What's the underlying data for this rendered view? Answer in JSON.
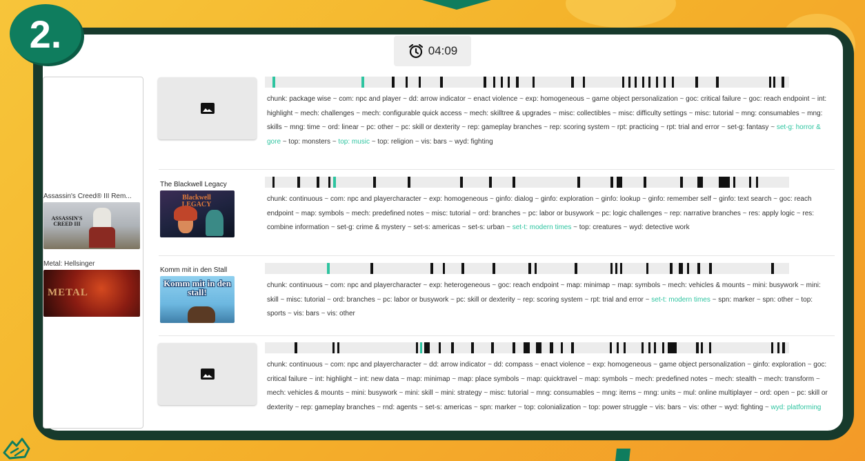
{
  "badge": {
    "step": "2."
  },
  "timer": {
    "time": "04:09",
    "icon": "alarm-clock-icon"
  },
  "left_panel": {
    "items": [
      {
        "title": "Assassin's Creed® III Rem...",
        "thumb_text": "ASSASSIN'S CREED III"
      },
      {
        "title": "Metal: Hellsinger",
        "thumb_text": "METAL"
      }
    ]
  },
  "rows": [
    {
      "title": "",
      "has_image": false,
      "marks": [
        [
          0.014,
          0.006,
          "teal"
        ],
        [
          0.184,
          0.006,
          "teal"
        ],
        [
          0.242,
          0.005,
          ""
        ],
        [
          0.268,
          0.005,
          ""
        ],
        [
          0.293,
          0.005,
          ""
        ],
        [
          0.334,
          0.005,
          ""
        ],
        [
          0.417,
          0.005,
          ""
        ],
        [
          0.436,
          0.004,
          ""
        ],
        [
          0.45,
          0.004,
          ""
        ],
        [
          0.463,
          0.004,
          ""
        ],
        [
          0.479,
          0.005,
          ""
        ],
        [
          0.51,
          0.005,
          ""
        ],
        [
          0.584,
          0.005,
          ""
        ],
        [
          0.606,
          0.005,
          ""
        ],
        [
          0.681,
          0.004,
          ""
        ],
        [
          0.693,
          0.004,
          ""
        ],
        [
          0.705,
          0.004,
          ""
        ],
        [
          0.72,
          0.004,
          ""
        ],
        [
          0.732,
          0.004,
          ""
        ],
        [
          0.746,
          0.004,
          ""
        ],
        [
          0.76,
          0.004,
          ""
        ],
        [
          0.776,
          0.004,
          ""
        ],
        [
          0.821,
          0.005,
          ""
        ],
        [
          0.861,
          0.005,
          ""
        ],
        [
          0.962,
          0.004,
          ""
        ],
        [
          0.97,
          0.004,
          ""
        ],
        [
          0.985,
          0.006,
          ""
        ]
      ],
      "tags": [
        {
          "t": "chunk: package wise"
        },
        {
          "t": "com: npc and player"
        },
        {
          "t": "dd: arrow indicator"
        },
        {
          "t": "enact violence"
        },
        {
          "t": "exp: homogeneous"
        },
        {
          "t": "game object personalization"
        },
        {
          "t": "goc: critical failure"
        },
        {
          "t": "goc: reach endpoint"
        },
        {
          "t": "int: highlight"
        },
        {
          "t": "mech: challenges"
        },
        {
          "t": "mech: configurable quick access"
        },
        {
          "t": "mech: skilltree & upgrades"
        },
        {
          "t": "misc: collectibles"
        },
        {
          "t": "misc: difficulty settings"
        },
        {
          "t": "misc: tutorial"
        },
        {
          "t": "mng: consumables"
        },
        {
          "t": "mng: skills"
        },
        {
          "t": "mng: time"
        },
        {
          "t": "ord: linear"
        },
        {
          "t": "pc: other"
        },
        {
          "t": "pc: skill or dexterity"
        },
        {
          "t": "rep: gameplay branches"
        },
        {
          "t": "rep: scoring system"
        },
        {
          "t": "rpt: practicing"
        },
        {
          "t": "rpt: trial and error"
        },
        {
          "t": "set-g: fantasy"
        },
        {
          "t": "set-g: horror & gore",
          "hl": true
        },
        {
          "t": "top: monsters"
        },
        {
          "t": "top: music",
          "hl": true
        },
        {
          "t": "top: religion"
        },
        {
          "t": "vis: bars"
        },
        {
          "t": "wyd: fighting"
        }
      ]
    },
    {
      "title": "The Blackwell Legacy",
      "has_image": true,
      "thumb_text": "Blackwell LEGACY",
      "marks": [
        [
          0.014,
          0.005,
          ""
        ],
        [
          0.062,
          0.005,
          ""
        ],
        [
          0.099,
          0.005,
          ""
        ],
        [
          0.121,
          0.004,
          ""
        ],
        [
          0.13,
          0.005,
          "teal"
        ],
        [
          0.207,
          0.005,
          ""
        ],
        [
          0.273,
          0.005,
          ""
        ],
        [
          0.373,
          0.005,
          ""
        ],
        [
          0.428,
          0.005,
          ""
        ],
        [
          0.472,
          0.005,
          ""
        ],
        [
          0.596,
          0.005,
          ""
        ],
        [
          0.659,
          0.005,
          ""
        ],
        [
          0.671,
          0.01,
          ""
        ],
        [
          0.723,
          0.005,
          ""
        ],
        [
          0.792,
          0.005,
          ""
        ],
        [
          0.825,
          0.01,
          ""
        ],
        [
          0.866,
          0.021,
          ""
        ],
        [
          0.893,
          0.005,
          ""
        ],
        [
          0.924,
          0.004,
          ""
        ],
        [
          0.937,
          0.004,
          ""
        ]
      ],
      "tags": [
        {
          "t": "chunk: continuous"
        },
        {
          "t": "com: npc and playercharacter"
        },
        {
          "t": "exp: homogeneous"
        },
        {
          "t": "ginfo: dialog"
        },
        {
          "t": "ginfo: exploration"
        },
        {
          "t": "ginfo: lookup"
        },
        {
          "t": "ginfo: remember self"
        },
        {
          "t": "ginfo: text search"
        },
        {
          "t": "goc: reach endpoint"
        },
        {
          "t": "map: symbols"
        },
        {
          "t": "mech: predefined notes"
        },
        {
          "t": "misc: tutorial"
        },
        {
          "t": "ord: branches"
        },
        {
          "t": "pc: labor or busywork"
        },
        {
          "t": "pc: logic challenges"
        },
        {
          "t": "rep: narrative branches"
        },
        {
          "t": "res: apply logic"
        },
        {
          "t": "res: combine information"
        },
        {
          "t": "set-g: crime & mystery"
        },
        {
          "t": "set-s: americas"
        },
        {
          "t": "set-s: urban"
        },
        {
          "t": "set-t: modern times",
          "hl": true
        },
        {
          "t": "top: creatures"
        },
        {
          "t": "wyd: detective work"
        }
      ]
    },
    {
      "title": "Komm mit in den Stall",
      "has_image": true,
      "thumb_text": "Komm mit in den stall!",
      "marks": [
        [
          0.119,
          0.005,
          "teal"
        ],
        [
          0.201,
          0.005,
          ""
        ],
        [
          0.316,
          0.005,
          ""
        ],
        [
          0.339,
          0.005,
          ""
        ],
        [
          0.375,
          0.005,
          ""
        ],
        [
          0.434,
          0.005,
          ""
        ],
        [
          0.503,
          0.005,
          ""
        ],
        [
          0.514,
          0.005,
          ""
        ],
        [
          0.591,
          0.005,
          ""
        ],
        [
          0.659,
          0.004,
          ""
        ],
        [
          0.668,
          0.004,
          ""
        ],
        [
          0.678,
          0.004,
          ""
        ],
        [
          0.727,
          0.005,
          ""
        ],
        [
          0.772,
          0.005,
          ""
        ],
        [
          0.789,
          0.008,
          ""
        ],
        [
          0.805,
          0.004,
          ""
        ],
        [
          0.825,
          0.005,
          ""
        ],
        [
          0.848,
          0.005,
          ""
        ],
        [
          0.966,
          0.005,
          ""
        ]
      ],
      "tags": [
        {
          "t": "chunk: continuous"
        },
        {
          "t": "com: npc and playercharacter"
        },
        {
          "t": "exp: heterogeneous"
        },
        {
          "t": "goc: reach endpoint"
        },
        {
          "t": "map: minimap"
        },
        {
          "t": "map: symbols"
        },
        {
          "t": "mech: vehicles & mounts"
        },
        {
          "t": "mini: busywork"
        },
        {
          "t": "mini: skill"
        },
        {
          "t": "misc: tutorial"
        },
        {
          "t": "ord: branches"
        },
        {
          "t": "pc: labor or busywork"
        },
        {
          "t": "pc: skill or dexterity"
        },
        {
          "t": "rep: scoring system"
        },
        {
          "t": "rpt: trial and error"
        },
        {
          "t": "set-t: modern times",
          "hl": true
        },
        {
          "t": "spn: marker"
        },
        {
          "t": "spn: other"
        },
        {
          "t": "top: sports"
        },
        {
          "t": "vis: bars"
        },
        {
          "t": "vis: other"
        }
      ]
    },
    {
      "title": "",
      "has_image": false,
      "marks": [
        [
          0.057,
          0.005,
          ""
        ],
        [
          0.129,
          0.004,
          ""
        ],
        [
          0.138,
          0.004,
          ""
        ],
        [
          0.288,
          0.004,
          ""
        ],
        [
          0.296,
          0.004,
          "teal"
        ],
        [
          0.304,
          0.01,
          ""
        ],
        [
          0.331,
          0.005,
          ""
        ],
        [
          0.355,
          0.005,
          ""
        ],
        [
          0.394,
          0.005,
          ""
        ],
        [
          0.432,
          0.005,
          ""
        ],
        [
          0.473,
          0.005,
          ""
        ],
        [
          0.493,
          0.012,
          ""
        ],
        [
          0.517,
          0.01,
          ""
        ],
        [
          0.544,
          0.006,
          ""
        ],
        [
          0.564,
          0.004,
          ""
        ],
        [
          0.584,
          0.005,
          ""
        ],
        [
          0.658,
          0.004,
          ""
        ],
        [
          0.671,
          0.004,
          ""
        ],
        [
          0.684,
          0.004,
          ""
        ],
        [
          0.718,
          0.004,
          ""
        ],
        [
          0.731,
          0.004,
          ""
        ],
        [
          0.742,
          0.004,
          ""
        ],
        [
          0.758,
          0.004,
          ""
        ],
        [
          0.768,
          0.018,
          ""
        ],
        [
          0.823,
          0.004,
          ""
        ],
        [
          0.832,
          0.004,
          ""
        ],
        [
          0.847,
          0.004,
          ""
        ],
        [
          0.966,
          0.004,
          ""
        ],
        [
          0.977,
          0.004,
          ""
        ],
        [
          0.987,
          0.005,
          ""
        ]
      ],
      "tags": [
        {
          "t": "chunk: continuous"
        },
        {
          "t": "com: npc and playercharacter"
        },
        {
          "t": "dd: arrow indicator"
        },
        {
          "t": "dd: compass"
        },
        {
          "t": "enact violence"
        },
        {
          "t": "exp: homogeneous"
        },
        {
          "t": "game object personalization"
        },
        {
          "t": "ginfo: exploration"
        },
        {
          "t": "goc: critical failure"
        },
        {
          "t": "int: highlight"
        },
        {
          "t": "int: new data"
        },
        {
          "t": "map: minimap"
        },
        {
          "t": "map: place symbols"
        },
        {
          "t": "map: quicktravel"
        },
        {
          "t": "map: symbols"
        },
        {
          "t": "mech: predefined notes"
        },
        {
          "t": "mech: stealth"
        },
        {
          "t": "mech: transform"
        },
        {
          "t": "mech: vehicles & mounts"
        },
        {
          "t": "mini: busywork"
        },
        {
          "t": "mini: skill"
        },
        {
          "t": "mini: strategy"
        },
        {
          "t": "misc: tutorial"
        },
        {
          "t": "mng: consumables"
        },
        {
          "t": "mng: items"
        },
        {
          "t": "mng: units"
        },
        {
          "t": "mul: online multiplayer"
        },
        {
          "t": "ord: open"
        },
        {
          "t": "pc: skill or dexterity"
        },
        {
          "t": "rep: gameplay branches"
        },
        {
          "t": "rnd: agents"
        },
        {
          "t": "set-s: americas"
        },
        {
          "t": "spn: marker"
        },
        {
          "t": "top: colonialization"
        },
        {
          "t": "top: power struggle"
        },
        {
          "t": "vis: bars"
        },
        {
          "t": "vis: other"
        },
        {
          "t": "wyd: fighting"
        },
        {
          "t": "wyd: platforming",
          "hl": true
        }
      ]
    }
  ],
  "colors": {
    "accent": "#2ec4a0",
    "brand": "#0f7d5e",
    "frame": "#173a2c"
  }
}
